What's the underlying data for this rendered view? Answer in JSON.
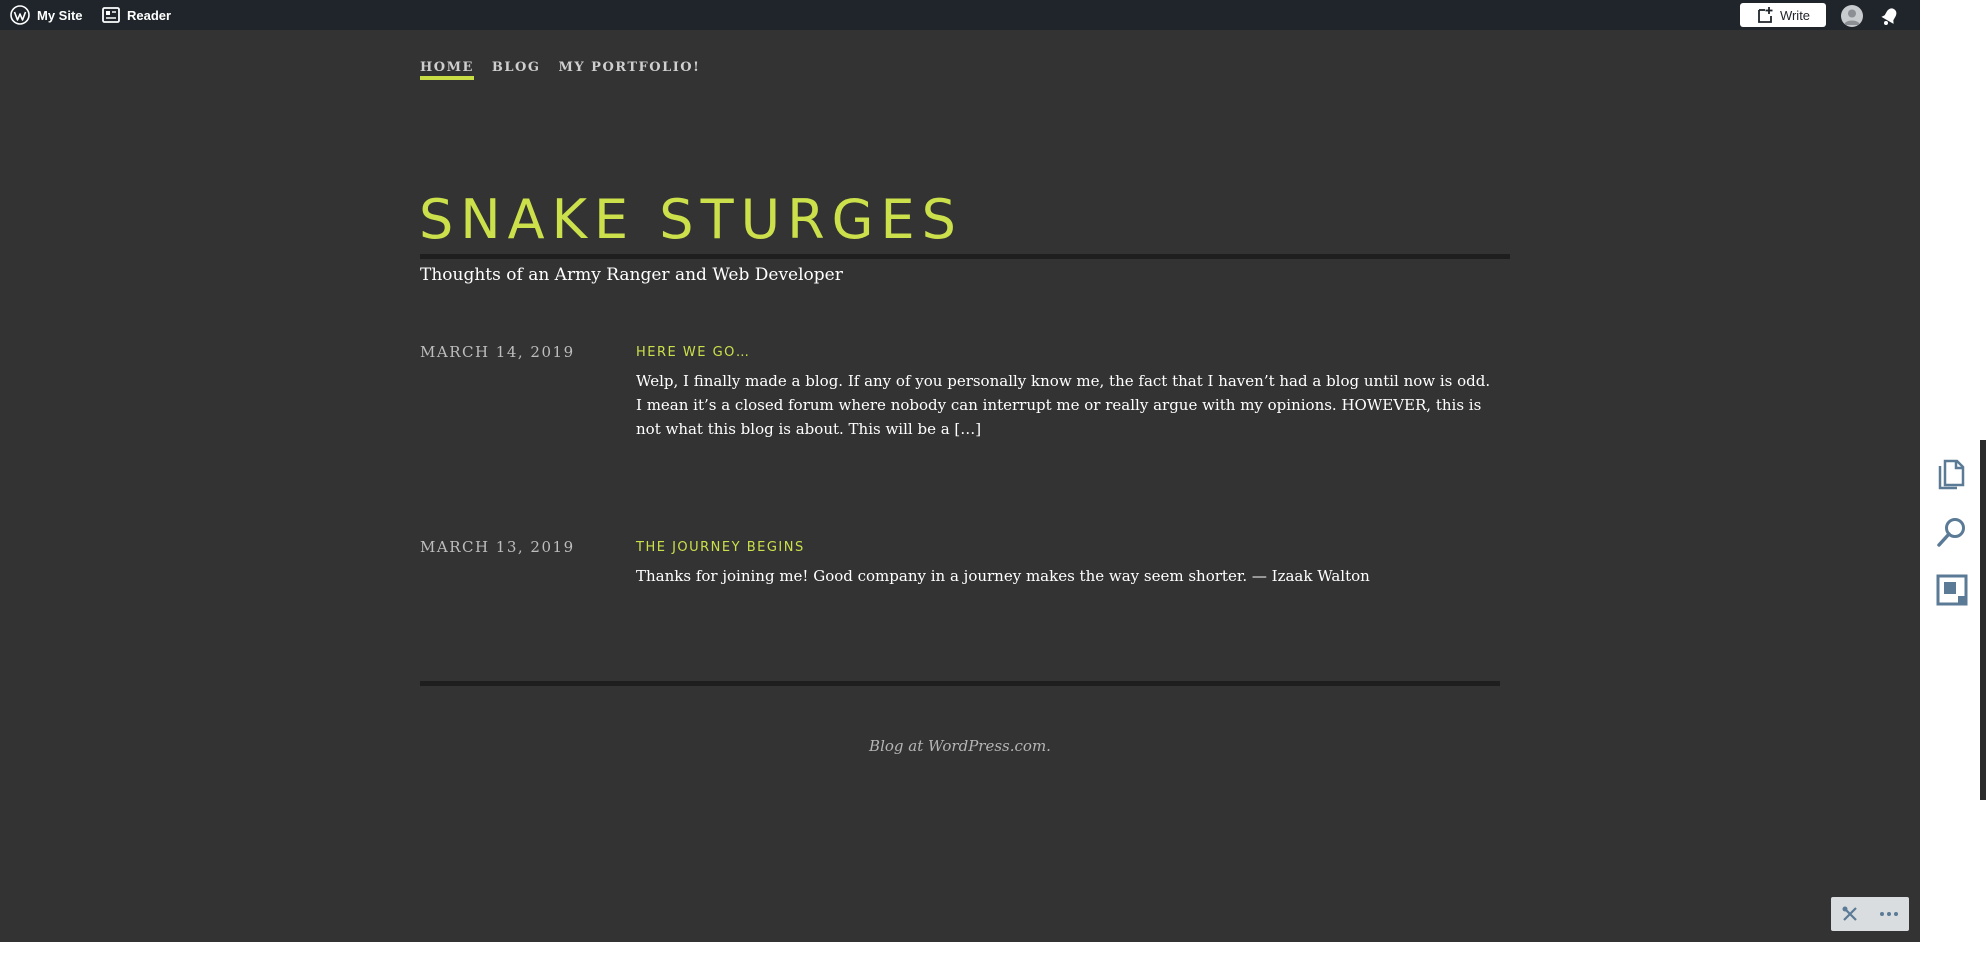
{
  "adminbar": {
    "my_site_label": "My Site",
    "reader_label": "Reader",
    "write_label": "Write"
  },
  "nav": {
    "items": [
      {
        "label": "HOME"
      },
      {
        "label": "BLOG"
      },
      {
        "label": "MY PORTFOLIO!"
      }
    ]
  },
  "header": {
    "title": "SNAKE STURGES",
    "tagline": "Thoughts of an Army Ranger and Web Developer"
  },
  "posts": [
    {
      "date": "MARCH 14, 2019",
      "title": "HERE WE GO…",
      "excerpt": "Welp, I finally made a blog. If any of you personally know me, the fact that I haven’t had a blog until now is odd. I mean it’s a closed forum where nobody can interrupt me or really argue with my opinions. HOWEVER, this is not what this blog is about. This will be a […]"
    },
    {
      "date": "MARCH 13, 2019",
      "title": "THE JOURNEY BEGINS",
      "excerpt": "Thanks for joining me! Good company in a journey makes the way seem shorter. — Izaak Walton"
    }
  ],
  "footer": {
    "credit": "Blog at WordPress.com."
  },
  "colors": {
    "accent": "#cbe04a",
    "background": "#333333",
    "adminbar": "#1f252b"
  },
  "icons": {
    "adminbar": [
      "wordpress-logo-icon",
      "reader-icon",
      "write-icon",
      "avatar",
      "notifications-bell-icon"
    ],
    "sidebar": [
      "pages-icon",
      "search-icon",
      "customize-icon"
    ],
    "mini_toolbar": [
      "tools-icon",
      "more-icon"
    ]
  }
}
